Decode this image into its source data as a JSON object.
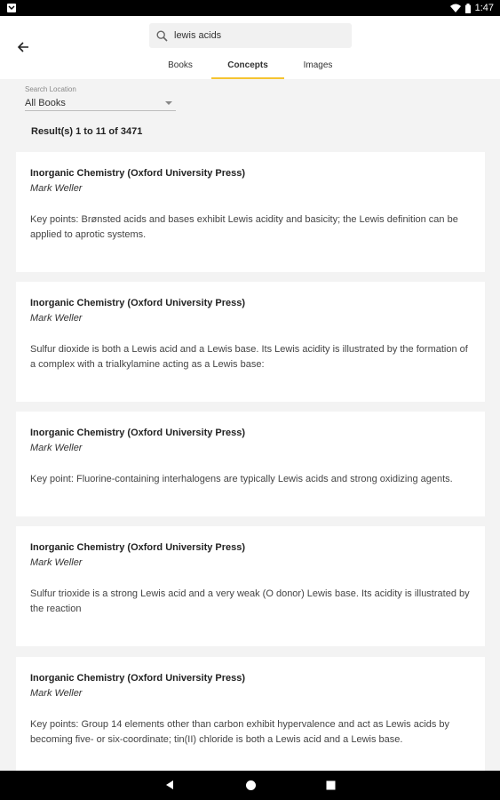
{
  "status_bar": {
    "time": "1:47"
  },
  "search": {
    "query": "lewis acids",
    "placeholder": ""
  },
  "tabs": [
    {
      "label": "Books"
    },
    {
      "label": "Concepts"
    },
    {
      "label": "Images"
    }
  ],
  "location": {
    "label": "Search Location",
    "value": "All Books"
  },
  "results": {
    "summary": "Result(s) 1 to 11 of 3471"
  },
  "cards": [
    {
      "title": "Inorganic Chemistry (Oxford University Press)",
      "author": "Mark Weller",
      "text": "Key points: Brønsted acids and bases exhibit Lewis acidity and basicity; the Lewis definition can be applied to aprotic systems."
    },
    {
      "title": "Inorganic Chemistry (Oxford University Press)",
      "author": "Mark Weller",
      "text": "Sulfur dioxide is both a Lewis acid and a Lewis base. Its Lewis acidity is illustrated by the formation of a complex with a trialkylamine acting as a Lewis base:"
    },
    {
      "title": "Inorganic Chemistry (Oxford University Press)",
      "author": "Mark Weller",
      "text": "Key point: Fluorine-containing interhalogens are typically Lewis acids and strong oxidizing agents."
    },
    {
      "title": "Inorganic Chemistry (Oxford University Press)",
      "author": "Mark Weller",
      "text": "Sulfur trioxide is a strong Lewis acid and a very weak (O donor) Lewis base. Its acidity is illustrated by the reaction"
    },
    {
      "title": "Inorganic Chemistry (Oxford University Press)",
      "author": "Mark Weller",
      "text": "Key points: Group 14 elements other than carbon exhibit hypervalence and act as Lewis acids by becoming five- or six-coordinate; tin(II) chloride is both a Lewis acid and a Lewis base."
    }
  ],
  "colors": {
    "accent": "#f5c431",
    "background": "#f3f3f3",
    "card": "#ffffff"
  },
  "icons": {
    "back": "arrow-left-icon",
    "search": "search-icon",
    "nav_back": "nav-back-icon",
    "nav_home": "nav-home-icon",
    "nav_recents": "nav-recents-icon"
  }
}
